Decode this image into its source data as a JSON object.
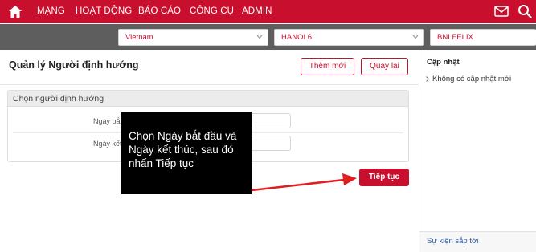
{
  "nav": {
    "items": [
      "MẠNG",
      "HOẠT ĐỘNG",
      "BÁO CÁO",
      "CÔNG CỤ",
      "ADMIN"
    ],
    "brand_color": "#c8102e"
  },
  "filters": {
    "country": "Vietnam",
    "region": "HANOI 6",
    "chapter": "BNI FELIX"
  },
  "main": {
    "title": "Quản lý Người định hướng",
    "add_button": "Thêm mới",
    "back_button": "Quay lại",
    "panel_title": "Chọn người định hướng",
    "start_label": "Ngày bắt đầu",
    "end_label": "Ngày kết thúc",
    "required_mark": "*",
    "start_value": "",
    "end_value": "",
    "next_button": "Tiếp tục"
  },
  "annotation": {
    "text": "Chọn Ngày bắt đầu và Ngày kết thúc, sau đó nhấn Tiếp tục"
  },
  "sidebar": {
    "title": "Cập nhật",
    "empty_text": "Không có cập nhật mới",
    "upcoming": "Sự kiện sắp tới"
  },
  "icons": {
    "home": "home-icon",
    "mail": "mail-icon",
    "search": "search-icon"
  }
}
